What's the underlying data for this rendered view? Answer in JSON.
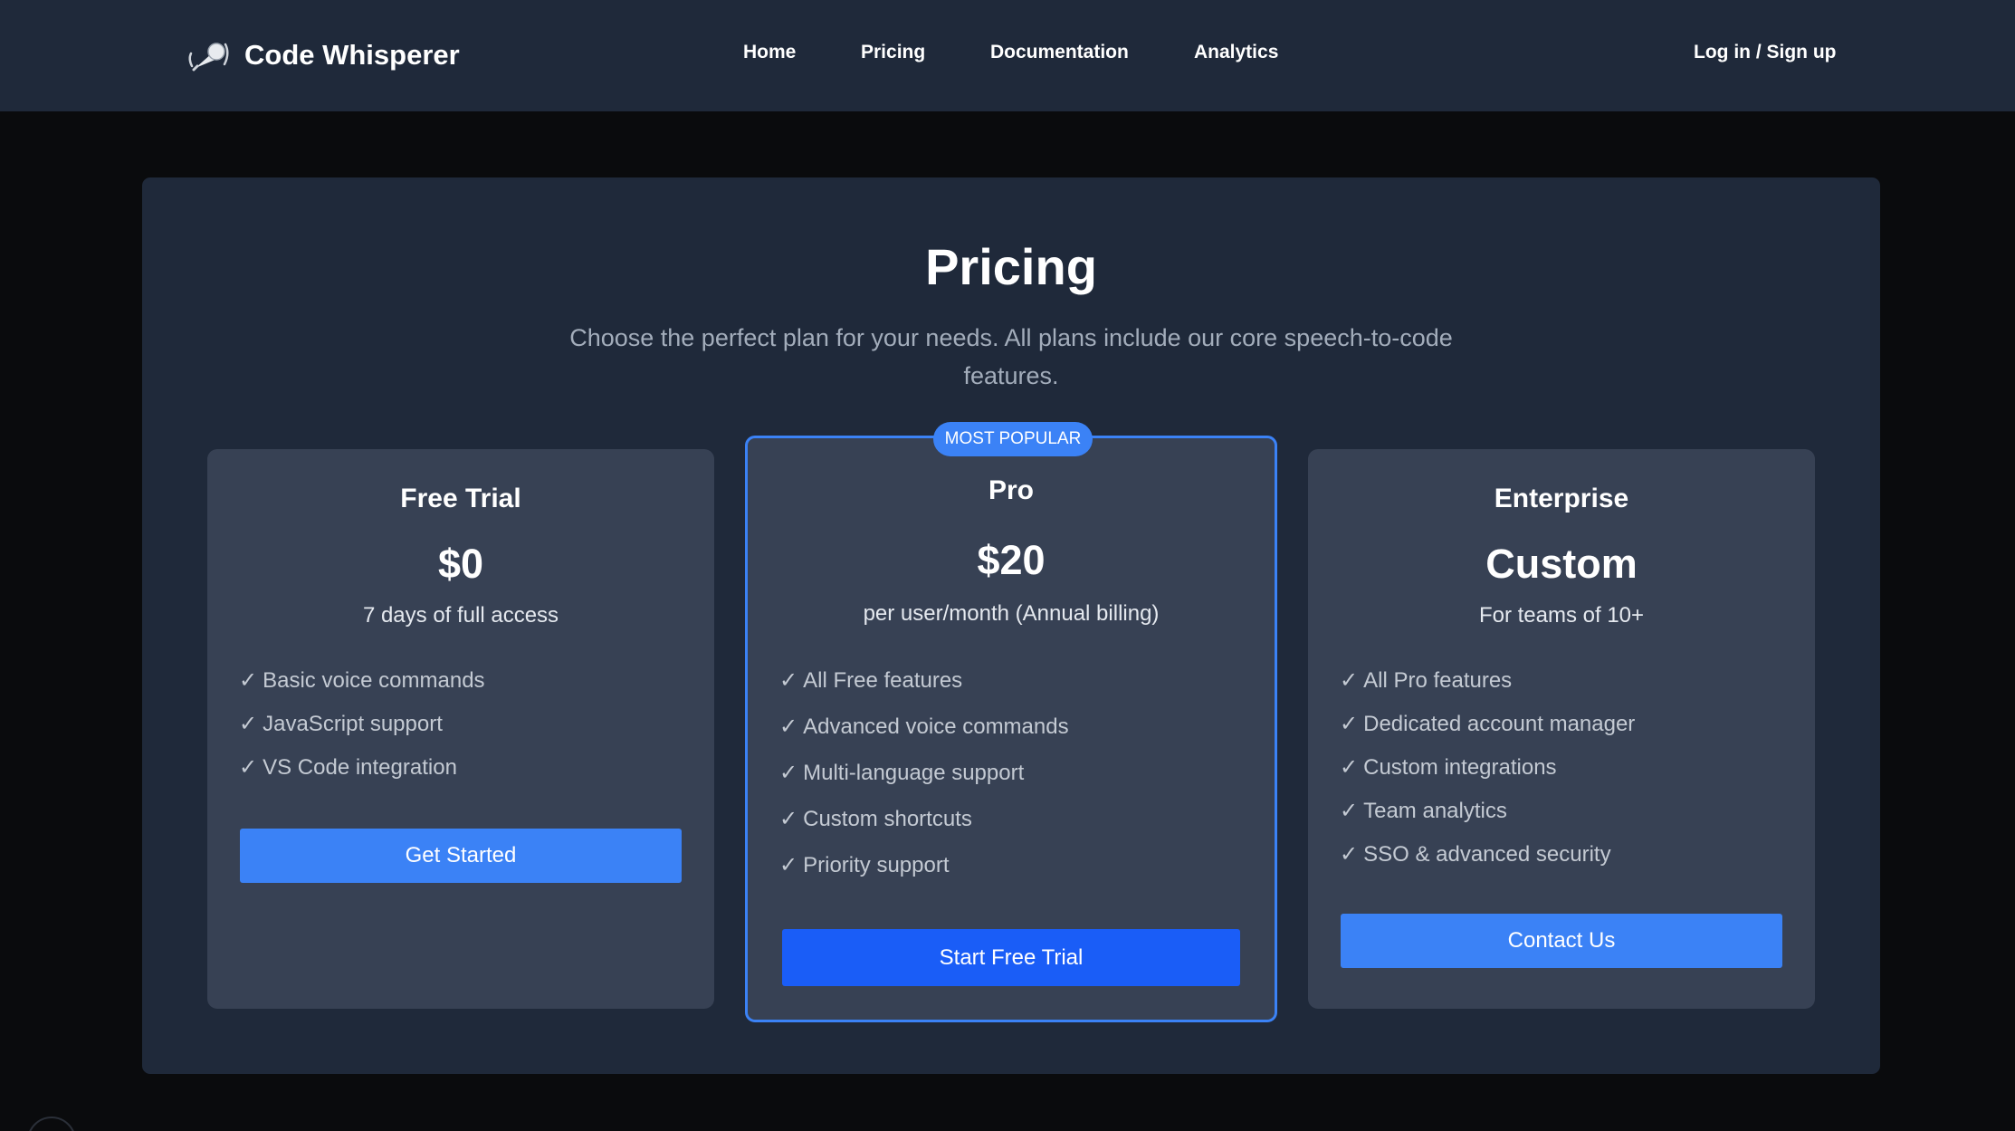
{
  "nav": {
    "brand": "Code Whisperer",
    "logo_icon": "microphone-icon",
    "links": [
      "Home",
      "Pricing",
      "Documentation",
      "Analytics"
    ],
    "auth": "Log in / Sign up"
  },
  "pricing": {
    "title": "Pricing",
    "subtitle": "Choose the perfect plan for your needs. All plans include our core speech-to-code features.",
    "plans": [
      {
        "name": "Free Trial",
        "price": "$0",
        "description": "7 days of full access",
        "features": [
          "Basic voice commands",
          "JavaScript support",
          "VS Code integration"
        ],
        "cta": "Get Started"
      },
      {
        "name": "Pro",
        "badge": "MOST POPULAR",
        "price": "$20",
        "description": "per user/month (Annual billing)",
        "features": [
          "All Free features",
          "Advanced voice commands",
          "Multi-language support",
          "Custom shortcuts",
          "Priority support"
        ],
        "cta": "Start Free Trial"
      },
      {
        "name": "Enterprise",
        "price": "Custom",
        "description": "For teams of 10+",
        "features": [
          "All Pro features",
          "Dedicated account manager",
          "Custom integrations",
          "Team analytics",
          "SSO & advanced security"
        ],
        "cta": "Contact Us"
      }
    ],
    "check_mark": "✓"
  },
  "colors": {
    "accent": "#3b82f6",
    "accent_strong": "#1a5df7",
    "nav_bg": "#1f293a",
    "panel_bg": "#1f293a",
    "card_bg": "#374154",
    "page_bg": "#0a0b0d"
  }
}
